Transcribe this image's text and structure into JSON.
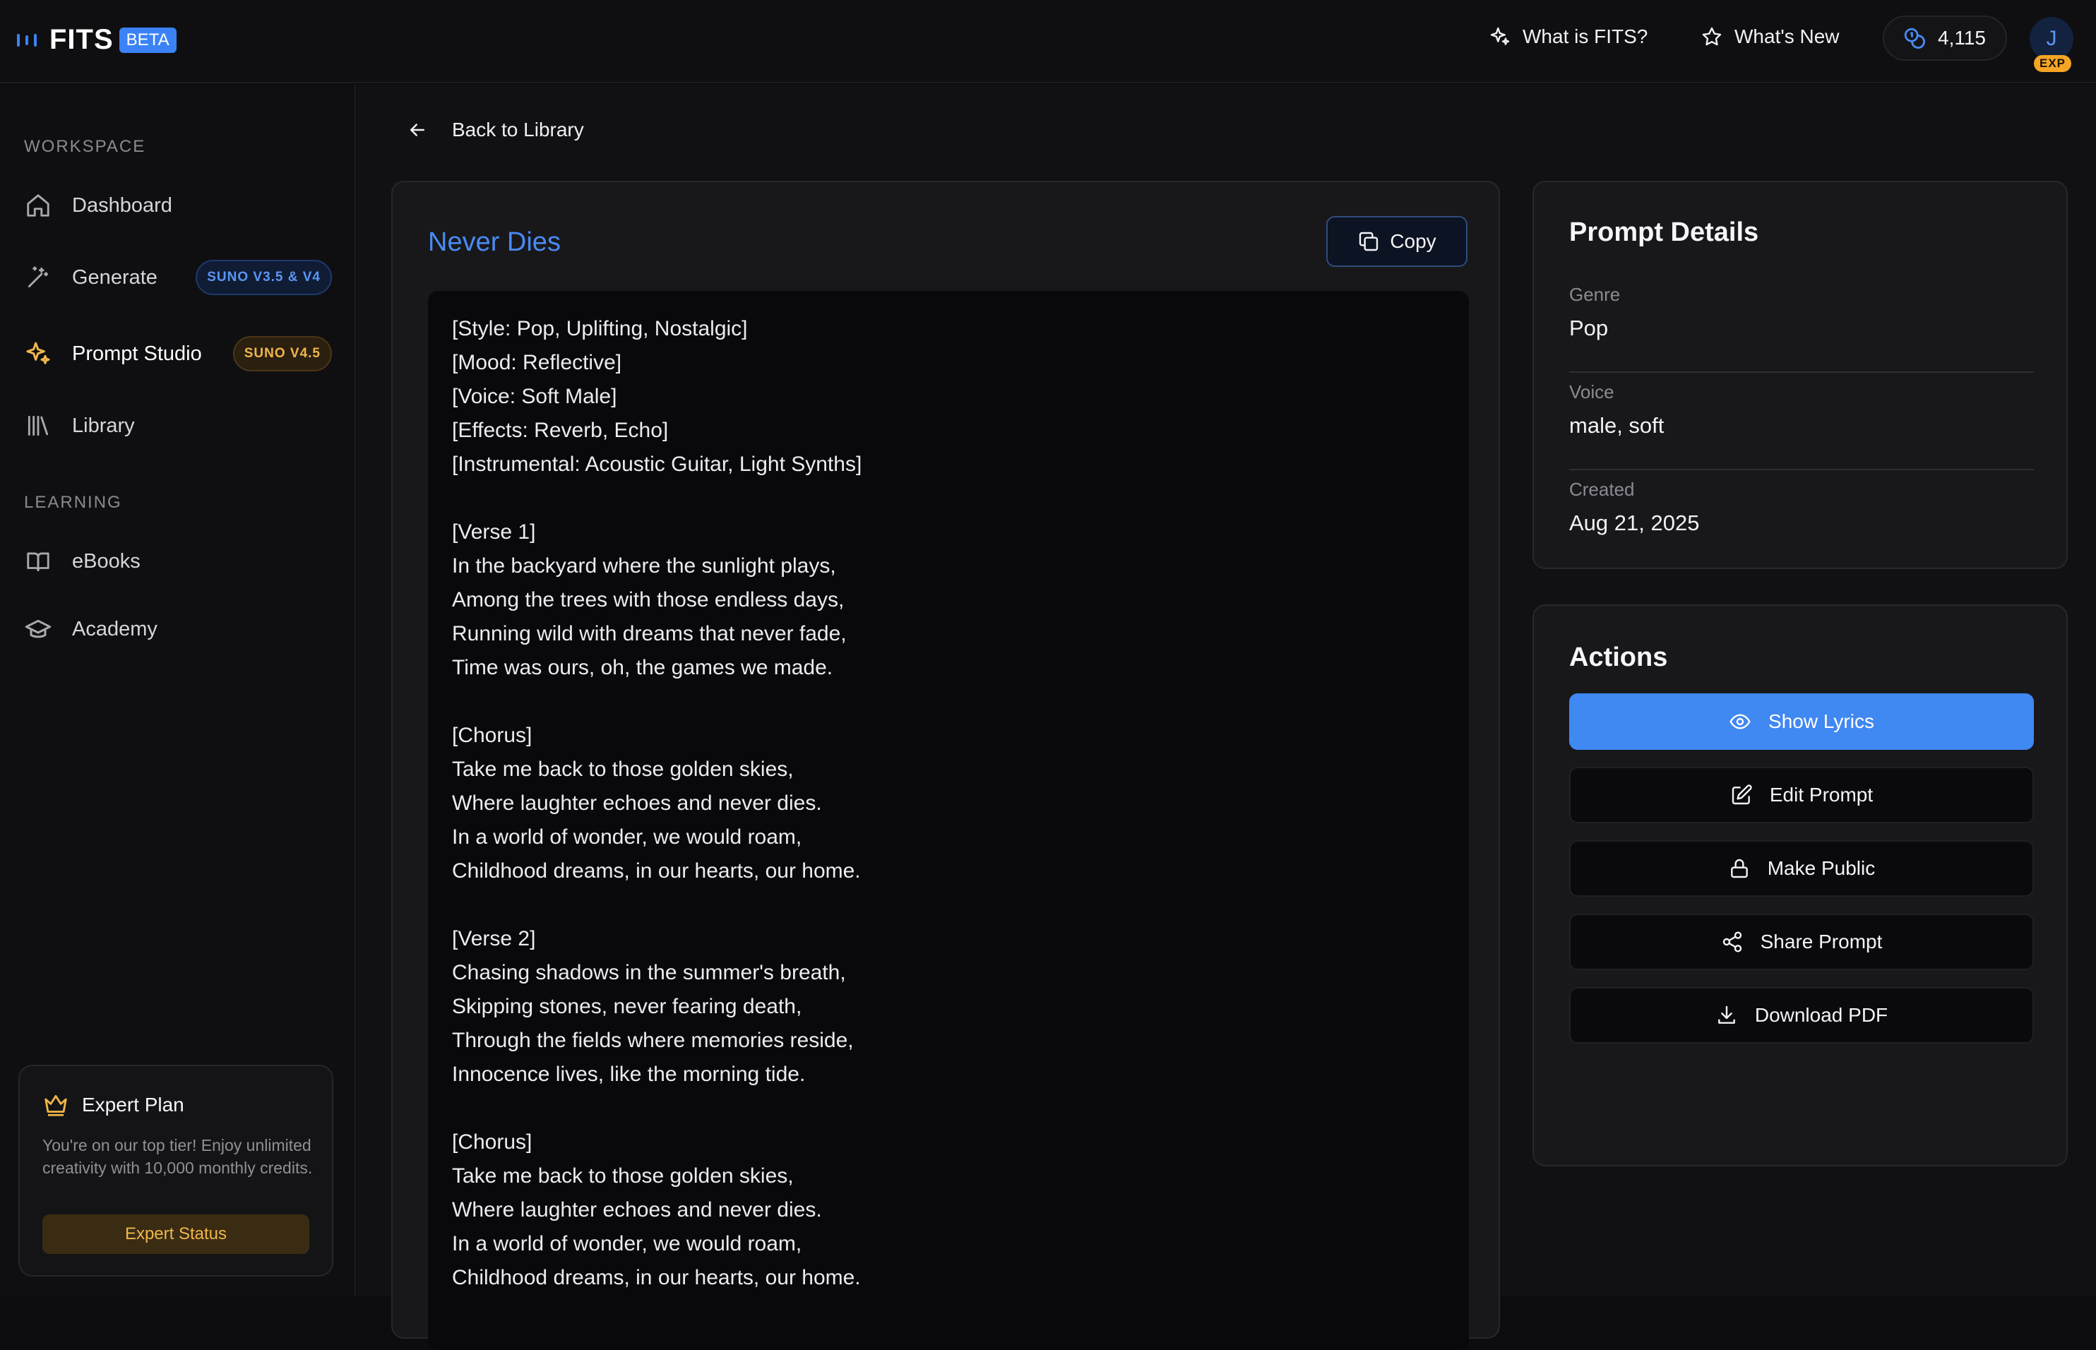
{
  "app": {
    "logo_text": "FITS",
    "beta_label": "BETA"
  },
  "topnav": {
    "what_is_label": "What is FITS?",
    "whats_new_label": "What's New",
    "credits": "4,115",
    "avatar_initial": "J",
    "exp_badge": "EXP"
  },
  "sidebar": {
    "workspace_label": "WORKSPACE",
    "learning_label": "LEARNING",
    "items": [
      {
        "label": "Dashboard"
      },
      {
        "label": "Generate",
        "badge": "SUNO V3.5 & V4"
      },
      {
        "label": "Prompt Studio",
        "badge": "SUNO V4.5"
      },
      {
        "label": "Library"
      },
      {
        "label": "eBooks"
      },
      {
        "label": "Academy"
      }
    ],
    "plan": {
      "title": "Expert Plan",
      "description": "You're on our top tier! Enjoy unlimited creativity with 10,000 monthly credits.",
      "button": "Expert Status"
    }
  },
  "main": {
    "back_label": "Back to Library",
    "song_title": "Never Dies",
    "copy_label": "Copy",
    "lyrics": [
      "[Style: Pop, Uplifting, Nostalgic]",
      "[Mood: Reflective]",
      "[Voice: Soft Male]",
      "[Effects: Reverb, Echo]",
      "[Instrumental: Acoustic Guitar, Light Synths]",
      "",
      "[Verse 1]",
      "In the backyard where the sunlight plays,",
      "Among the trees with those endless days,",
      "Running wild with dreams that never fade,",
      "Time was ours, oh, the games we made.",
      "",
      "[Chorus]",
      "Take me back to those golden skies,",
      "Where laughter echoes and never dies.",
      "In a world of wonder, we would roam,",
      "Childhood dreams, in our hearts, our home.",
      "",
      "[Verse 2]",
      "Chasing shadows in the summer's breath,",
      "Skipping stones, never fearing death,",
      "Through the fields where memories reside,",
      "Innocence lives, like the morning tide.",
      "",
      "[Chorus]",
      "Take me back to those golden skies,",
      "Where laughter echoes and never dies.",
      "In a world of wonder, we would roam,",
      "Childhood dreams, in our hearts, our home."
    ]
  },
  "details": {
    "title": "Prompt Details",
    "genre_label": "Genre",
    "genre_value": "Pop",
    "voice_label": "Voice",
    "voice_value": "male, soft",
    "created_label": "Created",
    "created_value": "Aug 21, 2025"
  },
  "actions": {
    "title": "Actions",
    "show_lyrics": "Show Lyrics",
    "edit_prompt": "Edit Prompt",
    "make_public": "Make Public",
    "share_prompt": "Share Prompt",
    "download_pdf": "Download PDF"
  },
  "colors": {
    "accent": "#4088f2",
    "gold": "#f0b64b",
    "background": "#0c0c0e"
  }
}
